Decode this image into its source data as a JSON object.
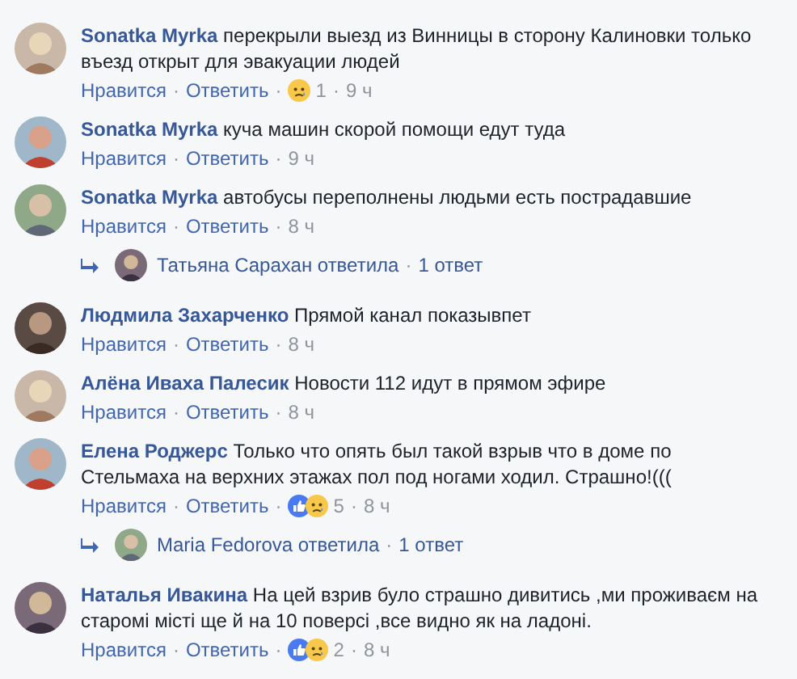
{
  "thread": [
    {
      "kind": "comment",
      "author": "Sonatka Myrka",
      "text": "перекрыли выезд из Винницы в сторону Калиновки только въезд открыт для эвакуации людей",
      "actions": [
        {
          "kind": "link",
          "text": "Нравится"
        },
        {
          "kind": "sep",
          "text": "·"
        },
        {
          "kind": "link",
          "text": "Ответить"
        },
        {
          "kind": "sep",
          "text": "·"
        },
        {
          "kind": "reactions",
          "icons": [
            {
              "kind": "sad"
            }
          ],
          "count": "1"
        },
        {
          "kind": "sep",
          "text": "·"
        },
        {
          "kind": "time",
          "text": "9 ч"
        }
      ]
    },
    {
      "kind": "comment",
      "author": "Sonatka Myrka",
      "text": "куча машин скорой помощи едут туда",
      "actions": [
        {
          "kind": "link",
          "text": "Нравится"
        },
        {
          "kind": "sep",
          "text": "·"
        },
        {
          "kind": "link",
          "text": "Ответить"
        },
        {
          "kind": "sep",
          "text": "·"
        },
        {
          "kind": "time",
          "text": "9 ч"
        }
      ]
    },
    {
      "kind": "comment",
      "author": "Sonatka Myrka",
      "text": "автобусы переполнены людьми есть пострадавшие",
      "actions": [
        {
          "kind": "link",
          "text": "Нравится"
        },
        {
          "kind": "sep",
          "text": "·"
        },
        {
          "kind": "link",
          "text": "Ответить"
        },
        {
          "kind": "sep",
          "text": "·"
        },
        {
          "kind": "time",
          "text": "8 ч"
        }
      ]
    },
    {
      "kind": "replies",
      "replier": "Татьяна Сарахан ответила",
      "separator": "·",
      "count": "1 ответ"
    },
    {
      "kind": "comment",
      "author": "Людмила Захарченко",
      "text": "Прямой канал показывпет",
      "actions": [
        {
          "kind": "link",
          "text": "Нравится"
        },
        {
          "kind": "sep",
          "text": "·"
        },
        {
          "kind": "link",
          "text": "Ответить"
        },
        {
          "kind": "sep",
          "text": "·"
        },
        {
          "kind": "time",
          "text": "8 ч"
        }
      ]
    },
    {
      "kind": "comment",
      "author": "Алёна Иваха Палесик",
      "text": "Новости 112 идут в прямом эфире",
      "actions": [
        {
          "kind": "link",
          "text": "Нравится"
        },
        {
          "kind": "sep",
          "text": "·"
        },
        {
          "kind": "link",
          "text": "Ответить"
        },
        {
          "kind": "sep",
          "text": "·"
        },
        {
          "kind": "time",
          "text": "8 ч"
        }
      ]
    },
    {
      "kind": "comment",
      "author": "Елена Роджерс",
      "text": "Только что опять был такой взрыв что в доме по Стельмаха на верхних этажах пол под ногами ходил. Страшно!(((",
      "actions": [
        {
          "kind": "link",
          "text": "Нравится"
        },
        {
          "kind": "sep",
          "text": "·"
        },
        {
          "kind": "link",
          "text": "Ответить"
        },
        {
          "kind": "sep",
          "text": "·"
        },
        {
          "kind": "reactions",
          "icons": [
            {
              "kind": "like"
            },
            {
              "kind": "sad"
            }
          ],
          "count": "5"
        },
        {
          "kind": "sep",
          "text": "·"
        },
        {
          "kind": "time",
          "text": "8 ч"
        }
      ]
    },
    {
      "kind": "replies",
      "replier": "Maria Fedorova ответила",
      "separator": "·",
      "count": "1 ответ"
    },
    {
      "kind": "comment",
      "author": "Наталья Ивакина",
      "text": "На цей взрив було страшно дивитись ,ми проживаєм на старомі місті ще й на 10 поверсі ,все видно як на ладоні.",
      "actions": [
        {
          "kind": "link",
          "text": "Нравится"
        },
        {
          "kind": "sep",
          "text": "·"
        },
        {
          "kind": "link",
          "text": "Ответить"
        },
        {
          "kind": "sep",
          "text": "·"
        },
        {
          "kind": "reactions",
          "icons": [
            {
              "kind": "like"
            },
            {
              "kind": "sad"
            }
          ],
          "count": "2"
        },
        {
          "kind": "sep",
          "text": "·"
        },
        {
          "kind": "time",
          "text": "8 ч"
        }
      ]
    }
  ]
}
